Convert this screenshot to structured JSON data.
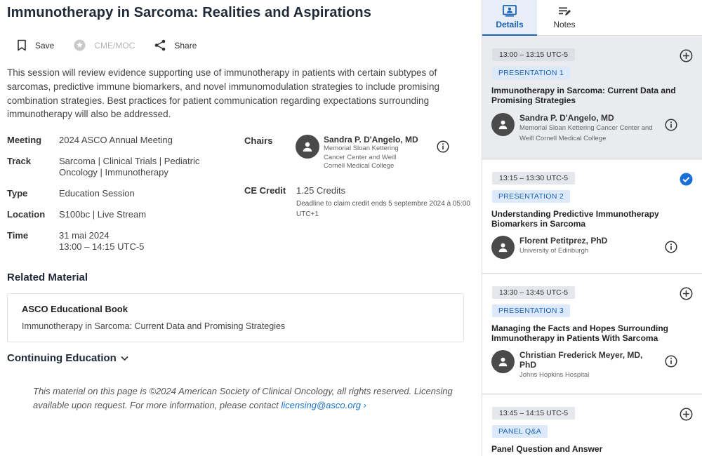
{
  "session": {
    "title": "Immunotherapy in Sarcoma: Realities and Aspirations",
    "description": "This session will review evidence supporting use of immunotherapy in patients with certain subtypes of sarcomas, predictive immune biomarkers, and novel immunomodulation strategies to include promising combination strategies. Best practices for patient communication regarding expectations surrounding immunotherapy will also be addressed."
  },
  "actions": {
    "save": "Save",
    "cme": "CME/MOC",
    "share": "Share"
  },
  "meta": {
    "meeting_label": "Meeting",
    "meeting": "2024 ASCO Annual Meeting",
    "track_label": "Track",
    "track": "Sarcoma | Clinical Trials | Pediatric Oncology | Immunotherapy",
    "type_label": "Type",
    "type": "Education Session",
    "location_label": "Location",
    "location": "S100bc | Live Stream",
    "time_label": "Time",
    "date": "31 mai 2024",
    "time": "13:00 – 14:15 UTC-5"
  },
  "chairs": {
    "label": "Chairs",
    "name": "Sandra P. D'Angelo, MD",
    "affiliation": "Memorial Sloan Kettering Cancer Center and Weill Cornell Medical College"
  },
  "ce_credit": {
    "label": "CE Credit",
    "value": "1.25 Credits",
    "deadline": "Deadline to claim credit ends 5 septembre 2024 à 05:00 UTC+1"
  },
  "related": {
    "heading": "Related Material",
    "book_title": "ASCO Educational Book",
    "book_subtitle": "Immunotherapy in Sarcoma: Current Data and Promising Strategies"
  },
  "continuing_education": "Continuing Education",
  "footer": {
    "text": "This material on this page is ©2024 American Society of Clinical Oncology, all rights reserved. Licensing available upon request. For more information, please contact ",
    "link": "licensing@asco.org ›"
  },
  "sidebar": {
    "tabs": [
      {
        "label": "Details",
        "icon": "person-card-icon",
        "active": true
      },
      {
        "label": "Notes",
        "icon": "notes-icon",
        "active": false
      }
    ],
    "items": [
      {
        "time": "13:00 – 13:15 UTC-5",
        "type": "PRESENTATION 1",
        "title": "Immunotherapy in Sarcoma: Current Data and Promising Strategies",
        "speaker": "Sandra P. D'Angelo, MD",
        "affiliation": "Memorial Sloan Kettering Cancer Center and Weill Cornell Medical College",
        "state": "add"
      },
      {
        "time": "13:15 – 13:30 UTC-5",
        "type": "PRESENTATION 2",
        "title": "Understanding Predictive Immunotherapy Biomarkers in Sarcoma",
        "speaker": "Florent Petitprez, PhD",
        "affiliation": "University of Edinburgh",
        "state": "checked"
      },
      {
        "time": "13:30 – 13:45 UTC-5",
        "type": "PRESENTATION 3",
        "title": "Managing the Facts and Hopes Surrounding Immunotherapy in Patients With Sarcoma",
        "speaker": "Christian Frederick Meyer, MD, PhD",
        "affiliation": "Johns Hopkins Hospital",
        "state": "add"
      },
      {
        "time": "13:45 – 14:15 UTC-5",
        "type": "PANEL Q&A",
        "title": "Panel Question and Answer",
        "state": "add"
      }
    ]
  },
  "colors": {
    "accent": "#1a62b8",
    "link": "#1a73c9",
    "chip_blue_bg": "#dce9fb"
  }
}
